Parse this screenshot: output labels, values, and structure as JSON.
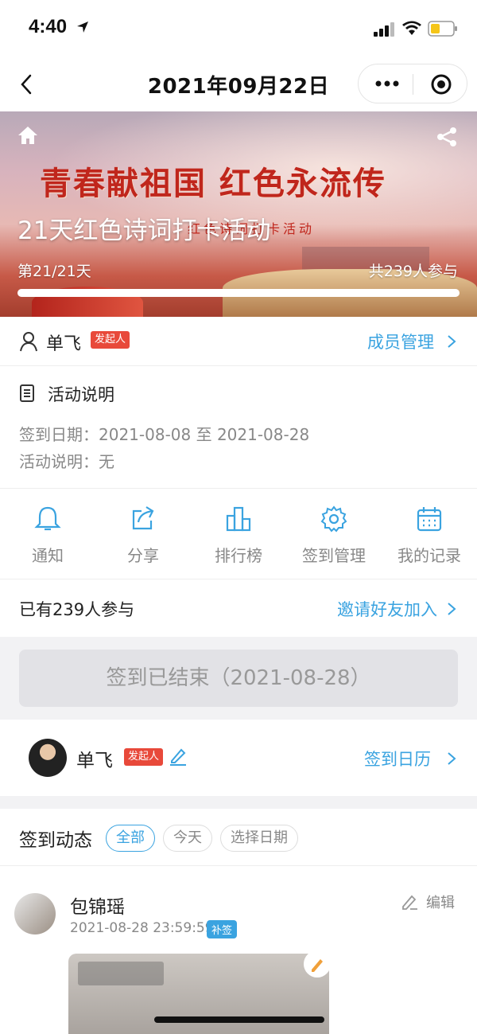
{
  "status_bar": {
    "time": "4:40"
  },
  "nav": {
    "title": "2021年09月22日"
  },
  "banner": {
    "slogan": "青春献祖国 红色永流传",
    "sub_slogan": "红色诗词打卡活动",
    "title": "21天红色诗词打卡活动",
    "day_progress": "第21/21天",
    "participant_total": "共239人参与",
    "progress_fraction": 1.0
  },
  "organizer": {
    "name": "单飞",
    "tag": "发起人",
    "member_link": "成员管理"
  },
  "description": {
    "title": "活动说明",
    "date_line": "签到日期：2021-08-08 至 2021-08-28",
    "note_line": "活动说明：无"
  },
  "actions": [
    {
      "label": "通知",
      "icon": "bell-icon"
    },
    {
      "label": "分享",
      "icon": "share-out-icon"
    },
    {
      "label": "排行榜",
      "icon": "ranking-icon"
    },
    {
      "label": "签到管理",
      "icon": "gear-icon"
    },
    {
      "label": "我的记录",
      "icon": "calendar-icon"
    }
  ],
  "participants": {
    "text": "已有239人参与",
    "invite": "邀请好友加入"
  },
  "checkin": {
    "ended_label": "签到已结束（2021-08-28）"
  },
  "me": {
    "name": "单飞",
    "tag": "发起人",
    "calendar_link": "签到日历"
  },
  "feed": {
    "title": "签到动态",
    "filters": [
      "全部",
      "今天",
      "选择日期"
    ],
    "active_filter": "全部",
    "posts": [
      {
        "name": "包锦瑶",
        "time": "2021-08-28 23:59:59",
        "tag": "补签",
        "edit": "编辑"
      }
    ]
  },
  "colors": {
    "accent": "#3aa3e0",
    "tag_red": "#e8493a"
  }
}
